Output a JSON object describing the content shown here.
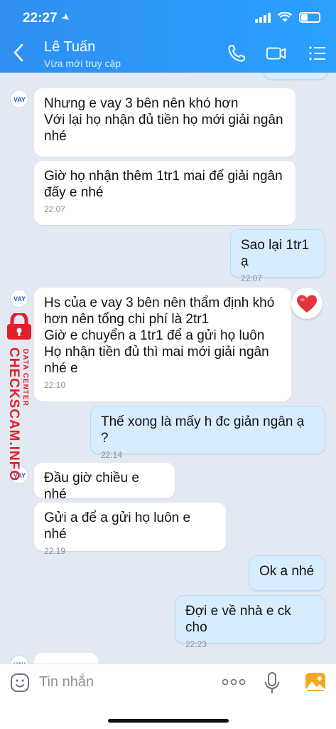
{
  "status_bar": {
    "time": "22:27"
  },
  "header": {
    "title": "Lê Tuấn",
    "subtitle": "Vừa mới truy cập"
  },
  "messages": [
    {
      "side": "in",
      "text": "Nhưng e vay 3 bên nên khó hơn\nVới lại họ nhận đủ tiền họ mới giải ngân nhé",
      "time": ""
    },
    {
      "side": "in",
      "text": "Giờ họ nhận thêm 1tr1 mai để giải ngân đấy e nhé",
      "time": "22:07"
    },
    {
      "side": "out",
      "text": "Sao lại 1tr1 ạ",
      "time": "22:07"
    },
    {
      "side": "in",
      "text": "Hs của e vay 3 bên nên thẩm định khó hơn nên tổng chi phí là 2tr1\nGiờ e chuyển a 1tr1 để a gửi họ luôn\nHọ nhận tiền đủ thì mai mới giải ngân nhé e",
      "time": "22:10"
    },
    {
      "side": "out",
      "text": "Thế xong là mấy h đc giản ngân ạ ?",
      "time": "22:14"
    },
    {
      "side": "in",
      "text": "Đầu giờ chiều e nhé",
      "time": ""
    },
    {
      "side": "in",
      "text": "Gửi a để a gửi họ luôn e nhé",
      "time": "22:19"
    },
    {
      "side": "out",
      "text": "Ok a nhé",
      "time": ""
    },
    {
      "side": "out",
      "text": "Đợi e về nhà e ck cho",
      "time": "22:23"
    }
  ],
  "watermark": {
    "main": "CHECKSCAM.INFO",
    "sub": "DATA CENTER"
  },
  "composer": {
    "placeholder": "Tin nhắn"
  },
  "colors": {
    "header": "#2f8ff2",
    "outgoing_bubble": "#d7ecfd",
    "incoming_bubble": "#ffffff",
    "chat_bg": "#e3e9f2",
    "watermark": "#e0202a"
  }
}
